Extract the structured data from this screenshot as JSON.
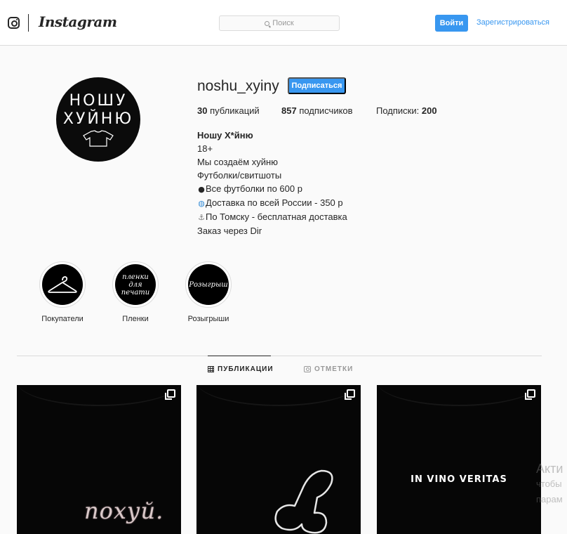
{
  "header": {
    "wordmark": "Instagram",
    "search": {
      "placeholder": "Поиск"
    },
    "login_label": "Войти",
    "signup_label": "Зарегистрироваться"
  },
  "profile": {
    "username": "noshu_xyiny",
    "avatar_text": {
      "line1": "НОШУ",
      "line2": "ХУЙНЮ"
    },
    "follow_label": "Подписаться",
    "stats": {
      "posts_value": "30",
      "posts_label": "публикаций",
      "followers_value": "857",
      "followers_label": "подписчиков",
      "following_label": "Подписки:",
      "following_value": "200"
    },
    "bio": {
      "name": "Ношу Х*йню",
      "lines": [
        "18+",
        "Мы создаём хуйню",
        "Футболки/свитшоты",
        "Все футболки по 600 р",
        "Доставка по всей России - 350 р",
        "По Томску - бесплатная доставка",
        "Заказ через Dir"
      ]
    }
  },
  "highlights": [
    {
      "label": "Покупатели",
      "icon": "hanger-icon"
    },
    {
      "label": "Пленки",
      "art": [
        "пленки",
        "для",
        "печати"
      ]
    },
    {
      "label": "Розыгрыши",
      "art": [
        "Розыгрыш"
      ]
    }
  ],
  "tabs": {
    "posts": "ПУБЛИКАЦИИ",
    "tagged": "ОТМЕТКИ"
  },
  "posts": [
    {
      "text": "похуй."
    },
    {
      "text": ""
    },
    {
      "text": "IN VINO VERITAS"
    }
  ],
  "watermark": {
    "line1": "Акти",
    "line2": "чтобы",
    "line3": "парам"
  },
  "colors": {
    "accent": "#3897f0",
    "text": "#262626",
    "border": "#dbdbdb",
    "background": "#fafafa"
  }
}
